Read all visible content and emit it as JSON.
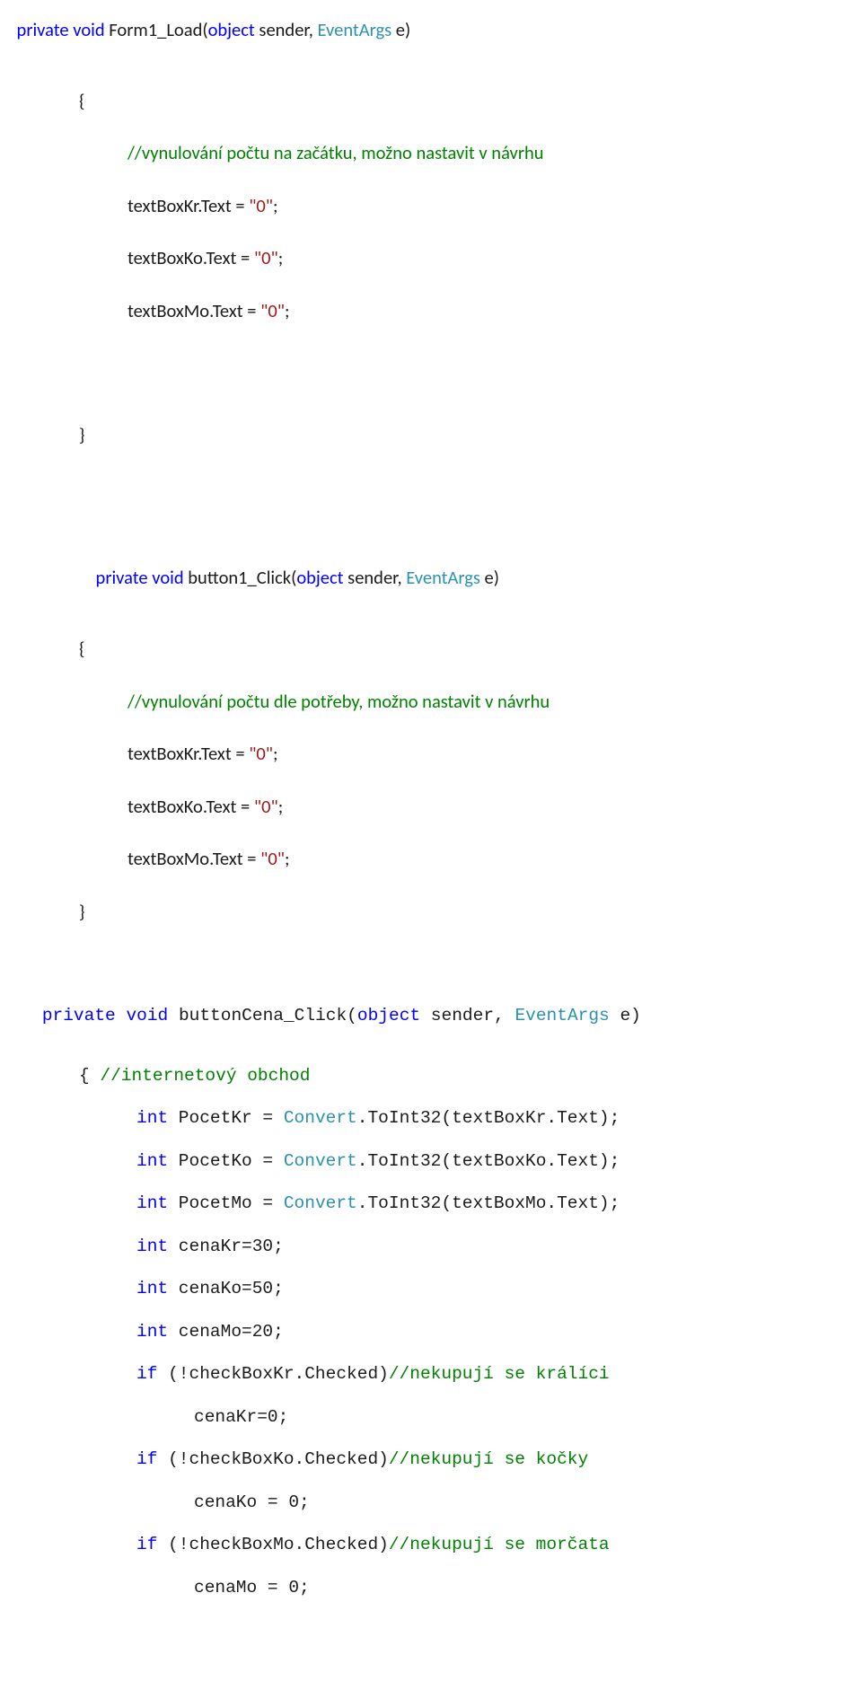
{
  "b1": {
    "sig1_kw1": "private",
    "sig1_kw2": "void",
    "sig1_name": " Form1_Load(",
    "sig1_kw3": "object",
    "sig1_mid": " sender, ",
    "sig1_type": "EventArgs",
    "sig1_end": " e)",
    "brace_open": "{",
    "brace_close": "}",
    "cmt1": "//vynulování počtu na začátku, možno nastavit v návrhu",
    "l_txtKr_a": "textBoxKr.Text = ",
    "l_txtKo_a": "textBoxKo.Text = ",
    "l_txtMo_a": "textBoxMo.Text = ",
    "strZero": "\"0\"",
    "semi": ";",
    "sig2_name": " button1_Click(",
    "cmt2": "//vynulování počtu dle potřeby, možno nastavit v návrhu"
  },
  "b2": {
    "sig_kw1": "private",
    "sig_kw2": "void",
    "sig_name": " buttonCena_Click(",
    "sig_kw3": "object",
    "sig_mid": " sender, ",
    "sig_type": "EventArgs",
    "sig_end": " e)",
    "brace_open": "{ ",
    "brace_open_bare": "{",
    "cmt_shop": "//internetový obchod",
    "int_kw": "int",
    "pocetKr_lhs": " PocetKr = ",
    "pocetKo_lhs": " PocetKo = ",
    "pocetMo_lhs": " PocetMo = ",
    "convert": "Convert",
    "toInt32_Kr": ".ToInt32(textBoxKr.Text);",
    "toInt32_Ko": ".ToInt32(textBoxKo.Text);",
    "toInt32_Mo": ".ToInt32(textBoxMo.Text);",
    "cenaKr_decl": " cenaKr=30;",
    "cenaKo_decl": " cenaKo=50;",
    "cenaMo_decl": " cenaMo=20;",
    "if_kw": "if",
    "if_kr_cond": " (!checkBoxKr.Checked)",
    "if_kr_cmt": "//nekupují se králíci",
    "if_kr_body": "cenaKr=0;",
    "if_ko_cond": " (!checkBoxKo.Checked)",
    "if_ko_cmt": "//nekupují se kočky",
    "if_ko_body": "cenaKo = 0;",
    "if_mo_cond": " (!checkBoxMo.Checked)",
    "if_mo_cmt": "//nekupují se morčata",
    "if_mo_body": "cenaMo = 0;"
  }
}
